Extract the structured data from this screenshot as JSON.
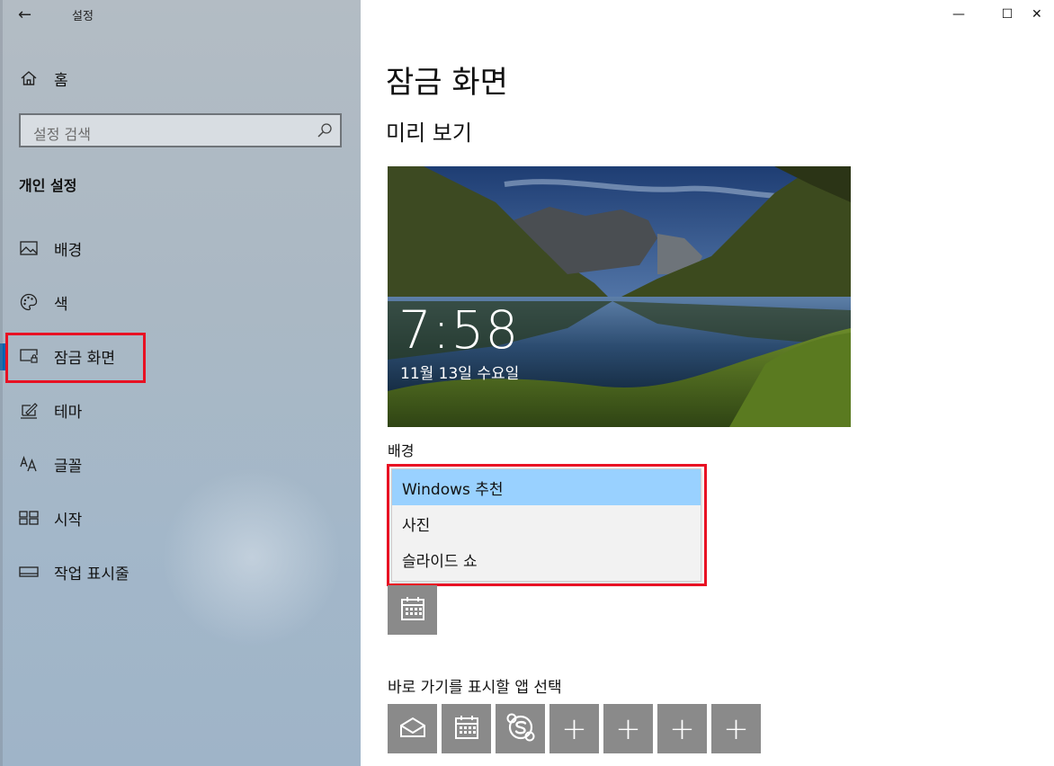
{
  "window": {
    "title": "설정",
    "back_glyph": "←",
    "minimize_glyph": "—",
    "maximize_glyph": "☐",
    "close_glyph": "✕"
  },
  "sidebar": {
    "home_label": "홈",
    "search_placeholder": "설정 검색",
    "section_label": "개인 설정",
    "items": [
      {
        "label": "배경",
        "icon": "picture-icon"
      },
      {
        "label": "색",
        "icon": "palette-icon"
      },
      {
        "label": "잠금 화면",
        "icon": "lock-screen-icon",
        "active": true
      },
      {
        "label": "테마",
        "icon": "theme-icon"
      },
      {
        "label": "글꼴",
        "icon": "font-icon"
      },
      {
        "label": "시작",
        "icon": "start-icon"
      },
      {
        "label": "작업 표시줄",
        "icon": "taskbar-icon"
      }
    ]
  },
  "main": {
    "title": "잠금 화면",
    "preview_heading": "미리 보기",
    "preview": {
      "time": "7:58",
      "date": "11월 13일 수요일"
    },
    "background_label": "배경",
    "background_options": [
      {
        "label": "Windows 추천",
        "selected": true
      },
      {
        "label": "사진",
        "selected": false
      },
      {
        "label": "슬라이드 쇼",
        "selected": false
      }
    ],
    "quick_status_icon": "calendar-icon",
    "apps_label": "바로 가기를 표시할 앱 선택",
    "app_tiles": [
      {
        "icon": "mail-icon"
      },
      {
        "icon": "calendar-icon"
      },
      {
        "icon": "skype-icon"
      },
      {
        "icon": "plus-icon",
        "glyph": "+"
      },
      {
        "icon": "plus-icon",
        "glyph": "+"
      },
      {
        "icon": "plus-icon",
        "glyph": "+"
      },
      {
        "icon": "plus-icon",
        "glyph": "+"
      }
    ]
  },
  "colors": {
    "highlight": "#e81123",
    "selected_option": "#99d1ff",
    "accent": "#0063b1",
    "tile": "#8a8a8a"
  }
}
